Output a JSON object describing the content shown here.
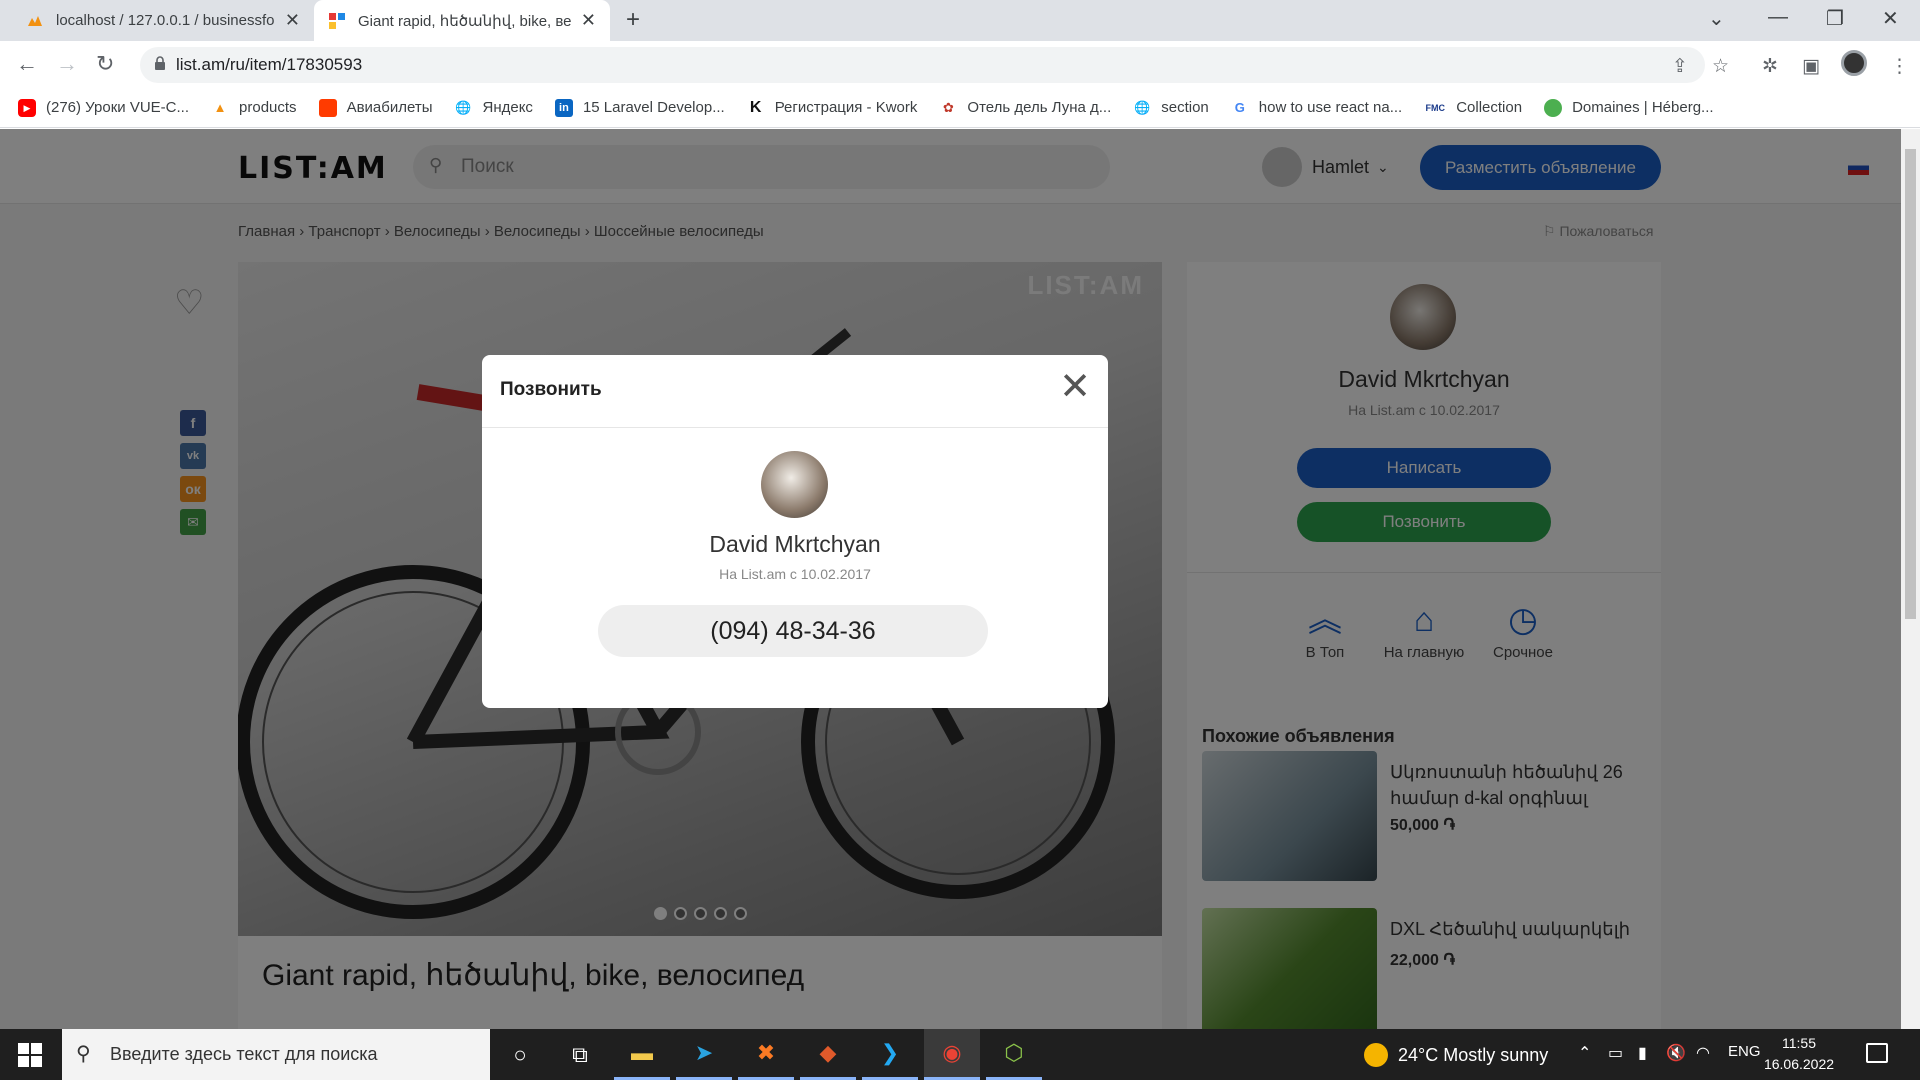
{
  "browser": {
    "tabs": [
      {
        "title": "localhost / 127.0.0.1 / businessfo",
        "active": false
      },
      {
        "title": "Giant rapid, հեծանիվ, bike, велос",
        "active": true
      }
    ],
    "url": "list.am/ru/item/17830593",
    "bookmarks": [
      {
        "label": "(276) Уроки VUE-C...",
        "icon": "youtube-icon",
        "color": "#ff0000"
      },
      {
        "label": "products",
        "icon": "phpmyadmin-icon",
        "color": "#f29111"
      },
      {
        "label": "Авиабилеты",
        "icon": "tickets-icon",
        "color": "#ff3b00"
      },
      {
        "label": "Яндекс",
        "icon": "globe-icon",
        "color": "#5f6368"
      },
      {
        "label": "15 Laravel Develop...",
        "icon": "linkedin-icon",
        "color": "#0a66c2"
      },
      {
        "label": "Регистрация - Kwork",
        "icon": "kwork-icon",
        "color": "#111111"
      },
      {
        "label": "Отель дель Луна д...",
        "icon": "dorama-icon",
        "color": "#c0392b"
      },
      {
        "label": "section",
        "icon": "globe-icon",
        "color": "#5f6368"
      },
      {
        "label": "how to use react na...",
        "icon": "google-icon",
        "color": "#4285f4"
      },
      {
        "label": "Collection",
        "icon": "fmc-icon",
        "color": "#1a3a8a"
      },
      {
        "label": "Domaines | Héberg...",
        "icon": "green-circle-icon",
        "color": "#4caf50"
      }
    ]
  },
  "site": {
    "logo": "LIST:AM",
    "search_placeholder": "Поиск",
    "user_name": "Hamlet",
    "post_button": "Разместить объявление",
    "breadcrumbs": "Главная › Транспорт › Велосипеды › Велосипеды › Шоссейные велосипеды",
    "report": "Пожаловаться",
    "watermark": "LIST:AM",
    "ad_title": "Giant rapid, հեծանիվ, bike, велосипед",
    "image_dots": 5,
    "seller": {
      "name": "David Mkrtchyan",
      "since": "На List.am с 10.02.2017",
      "write_button": "Написать",
      "call_button": "Позвонить"
    },
    "actions": [
      {
        "label": "В Топ",
        "icon": "double-chevron-up-icon"
      },
      {
        "label": "На главную",
        "icon": "home-icon"
      },
      {
        "label": "Срочное",
        "icon": "clock-icon"
      }
    ],
    "similar": {
      "title": "Похожие объявления",
      "items": [
        {
          "title": "Սկռոստանի հեծանիվ 26 համար d-kal օրգինալ",
          "price": "50,000 ֏"
        },
        {
          "title": "DXL Հեծանիվ սակարկելի",
          "price": "22,000 ֏"
        }
      ]
    }
  },
  "modal": {
    "title": "Позвонить",
    "name": "David Mkrtchyan",
    "since": "На List.am с 10.02.2017",
    "phone": "(094) 48-34-36"
  },
  "taskbar": {
    "search_placeholder": "Введите здесь текст для поиска",
    "weather": "24°C  Mostly sunny",
    "lang": "ENG",
    "time": "11:55",
    "date": "16.06.2022"
  }
}
